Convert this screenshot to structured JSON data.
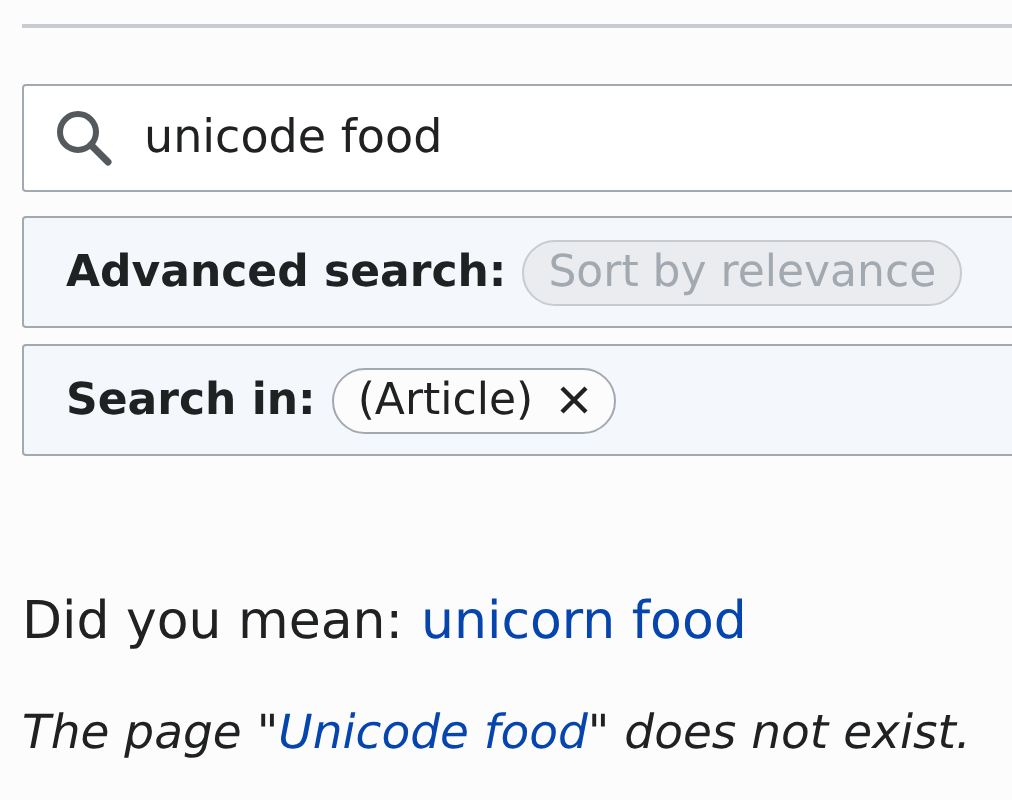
{
  "search": {
    "value": "unicode food"
  },
  "filters": [
    {
      "label": "Advanced search:",
      "chips": [
        {
          "text": "Sort by relevance",
          "disabled": true,
          "removable": false
        }
      ]
    },
    {
      "label": "Search in:",
      "chips": [
        {
          "text": "(Article)",
          "disabled": false,
          "removable": true
        }
      ]
    }
  ],
  "suggestion": {
    "label": "Did you mean:",
    "link": "unicorn food"
  },
  "notice": {
    "before": "The page \"",
    "link": "Unicode food",
    "after": "\" does not exist."
  }
}
